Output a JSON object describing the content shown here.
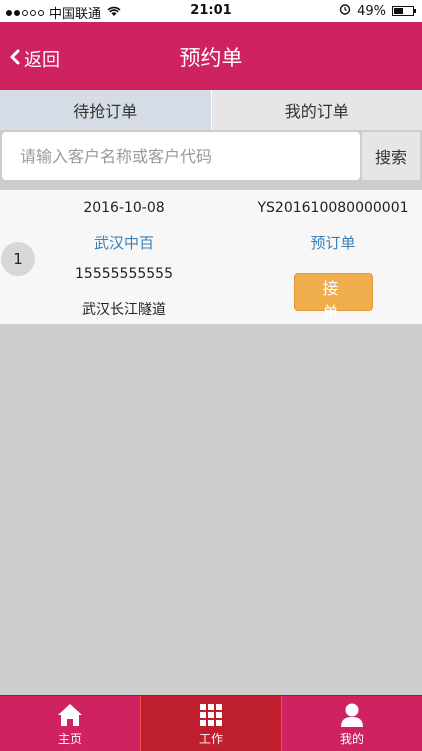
{
  "status_bar": {
    "carrier": "中国联通",
    "time": "21:01",
    "battery": "49%"
  },
  "nav": {
    "back_label": "返回",
    "title": "预约单"
  },
  "tabs": [
    {
      "label": "待抢订单",
      "active": true
    },
    {
      "label": "我的订单",
      "active": false
    }
  ],
  "search": {
    "placeholder": "请输入客户名称或客户代码",
    "button_label": "搜索"
  },
  "orders": [
    {
      "index": "1",
      "date": "2016-10-08",
      "order_no": "YS201610080000001",
      "customer": "武汉中百",
      "order_type": "预订单",
      "phone": "15555555555",
      "address": "武汉长江隧道",
      "action_label": "接 单"
    }
  ],
  "tabbar": [
    {
      "label": "主页",
      "icon": "home-icon",
      "active": false
    },
    {
      "label": "工作",
      "icon": "grid-icon",
      "active": true
    },
    {
      "label": "我的",
      "icon": "user-icon",
      "active": false
    }
  ],
  "colors": {
    "brand": "#cf2260",
    "link": "#3a7fb8",
    "accept": "#f0ad4e"
  }
}
